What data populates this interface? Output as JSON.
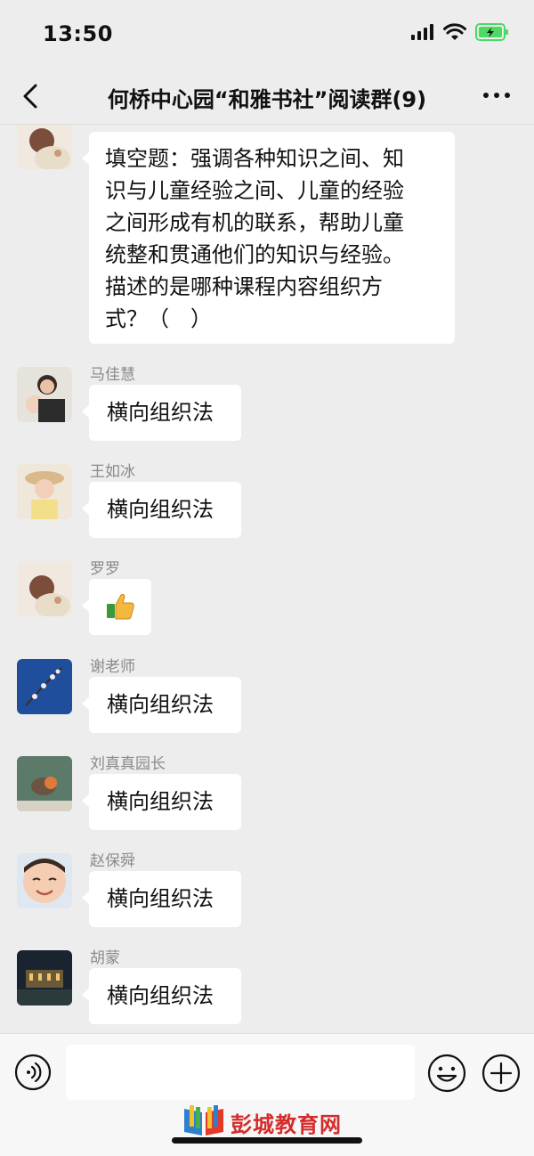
{
  "status": {
    "time": "13:50"
  },
  "header": {
    "title": "何桥中心园“和雅书社”阅读群(9)"
  },
  "messages": [
    {
      "sender": "",
      "text_lines": [
        "填空题：强调各种知识之间、知",
        "识与儿童经验之间、儿童的经验",
        "之间形成有机的联系，帮助儿童",
        "统整和贯通他们的知识与经验。",
        "描述的是哪种课程内容组织方",
        "式？（　）"
      ]
    },
    {
      "sender": "马佳慧",
      "text": "横向组织法"
    },
    {
      "sender": "王如冰",
      "text": "横向组织法"
    },
    {
      "sender": "罗罗",
      "text": "",
      "emoji": "thumbs-up"
    },
    {
      "sender": "谢老师",
      "text": "横向组织法"
    },
    {
      "sender": "刘真真园长",
      "text": "横向组织法"
    },
    {
      "sender": "赵保舜",
      "text": "横向组织法"
    },
    {
      "sender": "胡蒙",
      "text": "横向组织法"
    }
  ],
  "input": {
    "value": ""
  },
  "watermark": {
    "text": "彭城教育网"
  },
  "colors": {
    "background": "#ededed",
    "bubble": "#ffffff",
    "sender": "#8a8a8a",
    "battery": "#4cd964",
    "watermark": "#d62b2b"
  },
  "icons": [
    "back-arrow-icon",
    "more-dots-icon",
    "voice-icon",
    "emoji-icon",
    "plus-icon",
    "signal-icon",
    "wifi-icon",
    "battery-icon"
  ]
}
